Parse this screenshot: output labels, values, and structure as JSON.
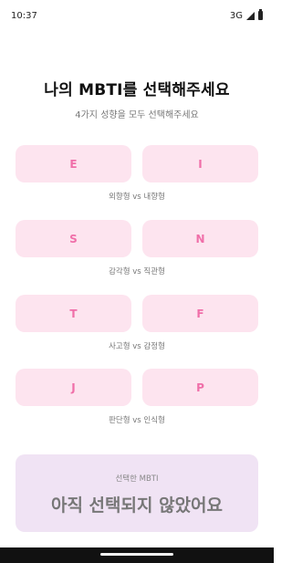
{
  "status_bar": {
    "time": "10:37",
    "network": "3G"
  },
  "header": {
    "title": "나의 MBTI를 선택해주세요",
    "subtitle": "4가지 성향을 모두 선택해주세요"
  },
  "pairs": [
    {
      "left": "E",
      "right": "I",
      "caption": "외향형 vs 내향형"
    },
    {
      "left": "S",
      "right": "N",
      "caption": "감각형 vs 직관형"
    },
    {
      "left": "T",
      "right": "F",
      "caption": "사고형 vs 감정형"
    },
    {
      "left": "J",
      "right": "P",
      "caption": "판단형 vs 인식형"
    }
  ],
  "result": {
    "label": "선택한 MBTI",
    "value": "아직 선택되지 않았어요"
  },
  "colors": {
    "choice_bg": "#fde4ef",
    "choice_text": "#f06fa9",
    "result_bg": "#f0e3f4"
  }
}
